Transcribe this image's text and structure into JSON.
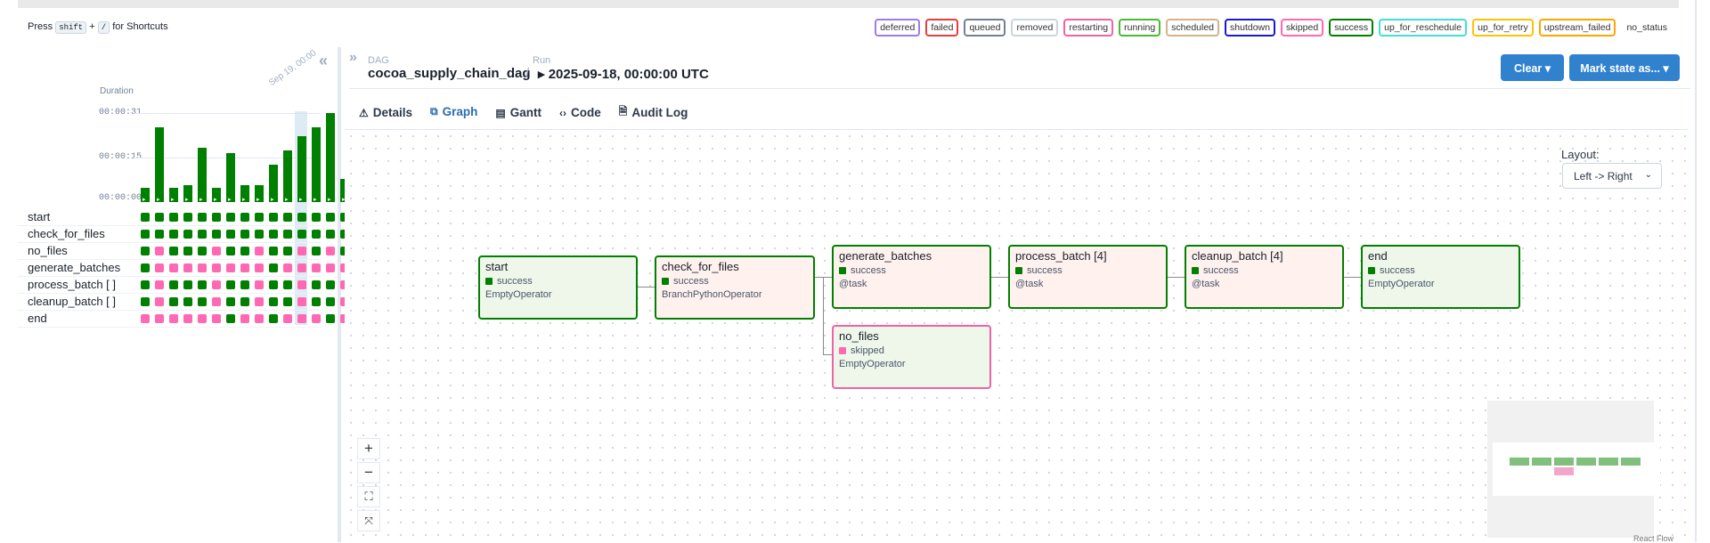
{
  "header": {
    "press_text": "Press",
    "plus": "+",
    "for_shortcuts": "for Shortcuts",
    "key_shift": "shift",
    "key_slash": "/"
  },
  "legend": [
    {
      "label": "deferred",
      "color": "#9f7aea"
    },
    {
      "label": "failed",
      "color": "#e53e3e"
    },
    {
      "label": "queued",
      "color": "#718096"
    },
    {
      "label": "removed",
      "color": "#cbd5e0"
    },
    {
      "label": "restarting",
      "color": "#ed64a6"
    },
    {
      "label": "running",
      "color": "#48bb30"
    },
    {
      "label": "scheduled",
      "color": "#d2b48c"
    },
    {
      "label": "shutdown",
      "color": "#1a1acd"
    },
    {
      "label": "skipped",
      "color": "#ff69b4"
    },
    {
      "label": "success",
      "color": "#008000"
    },
    {
      "label": "up_for_reschedule",
      "color": "#40e0d0"
    },
    {
      "label": "up_for_retry",
      "color": "#ffc107"
    },
    {
      "label": "upstream_failed",
      "color": "#ffa500"
    },
    {
      "label": "no_status",
      "color": "none"
    }
  ],
  "grid": {
    "duration_title": "Duration",
    "ticks": [
      "00:00:31",
      "00:00:15",
      "00:00:00"
    ],
    "selected_date": "Sep 19, 00:00",
    "durations_seconds": [
      5,
      26,
      5,
      6,
      19,
      5,
      17,
      6,
      6,
      13,
      18,
      23,
      26,
      31,
      8
    ],
    "task_names": [
      "start",
      "check_for_files",
      "no_files",
      "generate_batches",
      "process_batch [ ]",
      "cleanup_batch [ ]",
      "end"
    ],
    "run_states": [
      [
        "success",
        "success",
        "success",
        "success",
        "success",
        "success",
        "success",
        "success",
        "success",
        "success",
        "success",
        "success",
        "success",
        "success",
        "success"
      ],
      [
        "success",
        "success",
        "success",
        "success",
        "success",
        "success",
        "success",
        "success",
        "success",
        "success",
        "success",
        "success",
        "success",
        "success",
        "success"
      ],
      [
        "success",
        "skipped",
        "success",
        "success",
        "success",
        "skipped",
        "success",
        "success",
        "skipped",
        "success",
        "success",
        "skipped",
        "success",
        "skipped",
        "success"
      ],
      [
        "success",
        "skipped",
        "skipped",
        "skipped",
        "skipped",
        "skipped",
        "skipped",
        "skipped",
        "skipped",
        "success",
        "skipped",
        "skipped",
        "skipped",
        "skipped",
        "skipped"
      ],
      [
        "success",
        "skipped",
        "success",
        "success",
        "success",
        "skipped",
        "success",
        "success",
        "skipped",
        "success",
        "success",
        "skipped",
        "success",
        "success",
        "skipped"
      ],
      [
        "success",
        "skipped",
        "success",
        "success",
        "success",
        "skipped",
        "success",
        "success",
        "skipped",
        "success",
        "success",
        "skipped",
        "success",
        "success",
        "skipped"
      ],
      [
        "skipped",
        "skipped",
        "skipped",
        "skipped",
        "skipped",
        "skipped",
        "success",
        "skipped",
        "skipped",
        "success",
        "skipped",
        "skipped",
        "skipped",
        "success",
        "skipped"
      ]
    ]
  },
  "breadcrumb": {
    "dag_label": "DAG",
    "run_label": "Run",
    "dag_name": "cocoa_supply_chain_dag",
    "separator": "/",
    "run_name": "▸ 2025-09-18, 00:00:00 UTC"
  },
  "actions": {
    "clear": "Clear ▾",
    "mark_state": "Mark state as... ▾"
  },
  "tabs": [
    {
      "label": "Details",
      "icon": "⚠"
    },
    {
      "label": "Graph",
      "icon": "⧉"
    },
    {
      "label": "Gantt",
      "icon": "▤"
    },
    {
      "label": "Code",
      "icon": "‹›"
    },
    {
      "label": "Audit Log",
      "icon": "🗎"
    }
  ],
  "graph": {
    "layout_label": "Layout:",
    "layout_value": "Left -> Right",
    "nodes": [
      {
        "name": "start",
        "state": "success",
        "operator": "EmptyOperator"
      },
      {
        "name": "check_for_files",
        "state": "success",
        "operator": "BranchPythonOperator"
      },
      {
        "name": "generate_batches",
        "state": "success",
        "operator": "@task"
      },
      {
        "name": "process_batch [4]",
        "state": "success",
        "operator": "@task"
      },
      {
        "name": "cleanup_batch [4]",
        "state": "success",
        "operator": "@task"
      },
      {
        "name": "end",
        "state": "success",
        "operator": "EmptyOperator"
      },
      {
        "name": "no_files",
        "state": "skipped",
        "operator": "EmptyOperator"
      }
    ],
    "zoom_in": "+",
    "zoom_out": "−",
    "fit": "⛶",
    "interactive": "⤧",
    "attribution": "React Flow"
  },
  "colors": {
    "success": "#008000",
    "skipped": "#ff69b4",
    "accent": "#3182ce"
  }
}
